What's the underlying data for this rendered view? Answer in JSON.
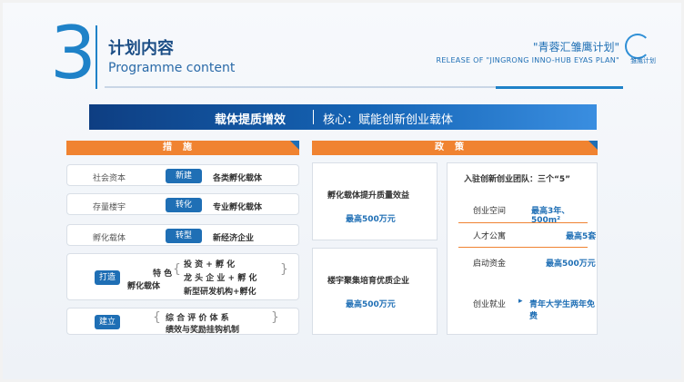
{
  "header": {
    "number": "3",
    "title": "计划内容",
    "subtitle": "Programme content",
    "brand_cn": "\"青蓉汇雏鹰计划\"",
    "brand_en": "RELEASE OF \"JINGRONG INNO-HUB EYAS PLAN\"",
    "logo_text": "雏鹰计划",
    "logo_icon": "eagle-logo"
  },
  "banner": {
    "left": "载体提质增效",
    "right": "核心：赋能创新创业载体"
  },
  "measures": {
    "header": "措施",
    "rows": [
      {
        "label": "社会资本",
        "action": "新建",
        "result": "各类孵化载体"
      },
      {
        "label": "存量楼宇",
        "action": "转化",
        "result": "专业孵化载体"
      },
      {
        "label": "孵化载体",
        "action": "转型",
        "result": "新经济企业"
      }
    ],
    "create": {
      "tag": "打造",
      "name_line1": "特 色",
      "name_line2": "孵化载体",
      "items": [
        "投 资 + 孵 化",
        "龙 头 企 业 + 孵 化",
        "新型研发机构+孵化"
      ]
    },
    "establish": {
      "tag": "建立",
      "line1": "综 合 评 价 体 系",
      "line2": "绩效与奖励挂钩机制"
    }
  },
  "policy": {
    "header": "政策",
    "left_boxes": [
      {
        "title": "孵化载体提升质量效益",
        "value": "最高500万元"
      },
      {
        "title": "楼宇聚集培育优质企业",
        "value": "最高500万元"
      }
    ],
    "team": {
      "title": "入驻创新创业团队：三个“5”",
      "rows": [
        {
          "label": "创业空间",
          "value": "最高3年、500m²"
        },
        {
          "label": "人才公寓",
          "value": "最高5套"
        },
        {
          "label": "启动资金",
          "value": "最高500万元"
        },
        {
          "label": "创业就业",
          "value": "青年大学生两年免费",
          "arrow": "▸"
        }
      ]
    }
  },
  "colors": {
    "primary_blue": "#1f6fb5",
    "orange": "#f08331",
    "navy": "#0e3e82"
  }
}
